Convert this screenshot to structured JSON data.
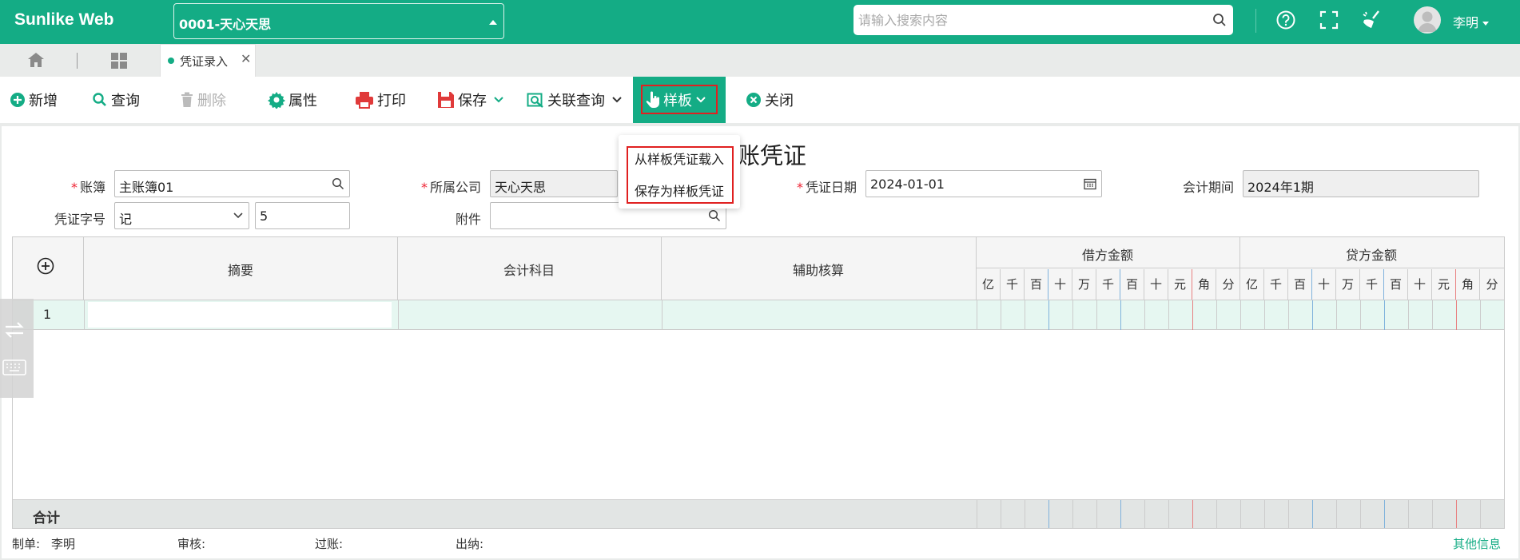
{
  "app": {
    "title": "Sunlike Web"
  },
  "header": {
    "company": "0001-天心天思",
    "search_placeholder": "请输入搜索内容",
    "user": "李明",
    "icons": [
      "help-icon",
      "fullscreen-icon",
      "broom-icon",
      "avatar-icon"
    ]
  },
  "tabs": {
    "active": "凭证录入"
  },
  "toolbar": {
    "new": "新增",
    "query": "查询",
    "delete": "删除",
    "properties": "属性",
    "print": "打印",
    "save": "保存",
    "related_query": "关联查询",
    "sample": "样板",
    "close": "关闭"
  },
  "dropdown": {
    "items": [
      "从样板凭证载入",
      "保存为样板凭证"
    ]
  },
  "voucher": {
    "title_visible": "账凭证",
    "book_label": "账簿",
    "book_value": "主账簿01",
    "company_label": "所属公司",
    "company_value": "天心天思",
    "date_label": "凭证日期",
    "date_value": "2024-01-01",
    "period_label": "会计期间",
    "period_value": "2024年1期",
    "word_label": "凭证字号",
    "word_value": "记",
    "number_value": "5",
    "attach_label": "附件"
  },
  "grid": {
    "columns": {
      "summary": "摘要",
      "account": "会计科目",
      "aux": "辅助核算",
      "debit": "借方金额",
      "credit": "贷方金额"
    },
    "digits": [
      "亿",
      "千",
      "百",
      "十",
      "万",
      "千",
      "百",
      "十",
      "元",
      "角",
      "分"
    ],
    "rows": [
      {
        "no": "1"
      }
    ],
    "total_label": "合计"
  },
  "footer": {
    "maker_label": "制单:",
    "maker": "李明",
    "audit_label": "审核:",
    "post_label": "过账:",
    "cashier_label": "出纳:",
    "other_info": "其他信息"
  },
  "colors": {
    "brand": "#14ac85",
    "highlight_border": "#e02020"
  }
}
